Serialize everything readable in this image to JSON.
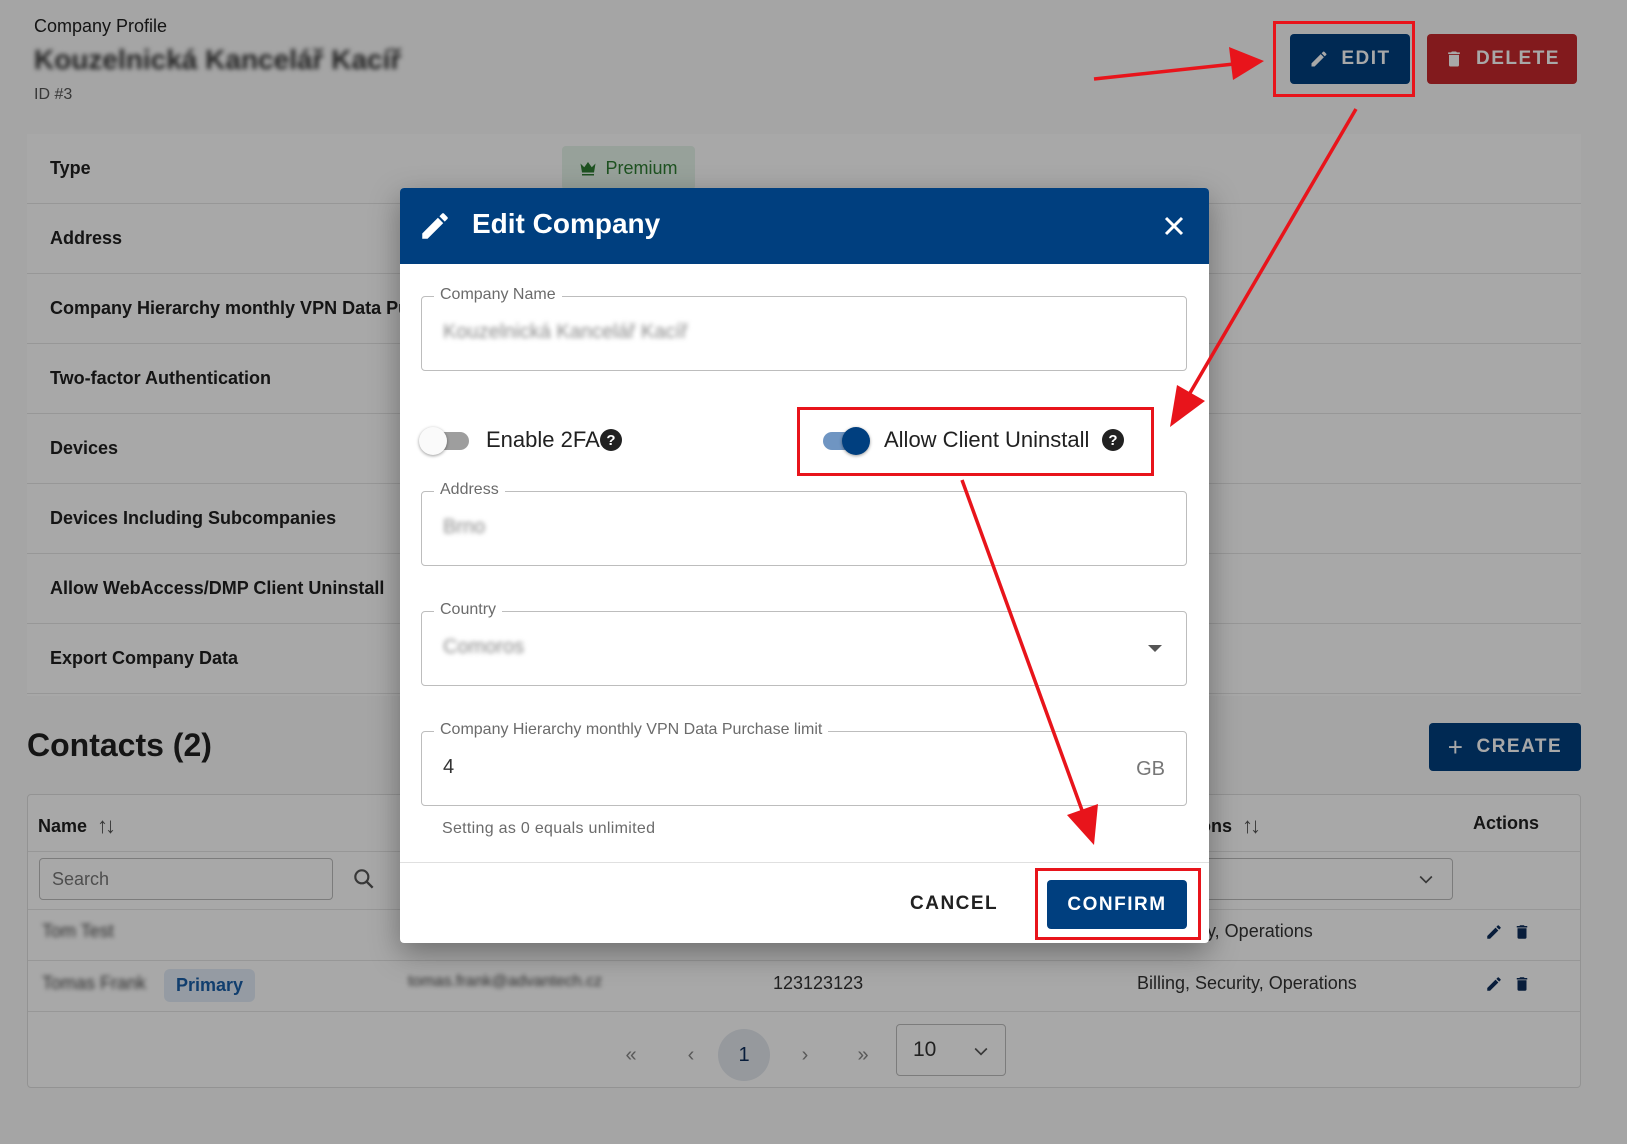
{
  "header": {
    "profile_label": "Company Profile",
    "company_name": "Kouzelnická Kancelář Kacíř",
    "company_id": "ID #3",
    "edit_label": "EDIT",
    "delete_label": "DELETE"
  },
  "details": {
    "rows": [
      "Type",
      "Address",
      "Company Hierarchy monthly VPN Data Pu",
      "Two-factor Authentication",
      "Devices",
      "Devices Including Subcompanies",
      "Allow WebAccess/DMP Client Uninstall",
      "Export Company Data"
    ],
    "type_badge": "Premium"
  },
  "contacts": {
    "title": "Contacts (2)",
    "create_label": "CREATE",
    "columns": {
      "name": "Name",
      "roles": "ons",
      "actions": "Actions"
    },
    "search_placeholder": "Search",
    "rows": [
      {
        "name": "Tom Test",
        "email": "",
        "phone": "",
        "roles": "ecurity, Operations"
      },
      {
        "name": "Tomas Frank",
        "badge": "Primary",
        "email": "tomas.frank@advantech.cz",
        "phone": "123123123",
        "roles": "Billing, Security, Operations"
      }
    ],
    "pagination": {
      "first": "«",
      "prev": "‹",
      "current": "1",
      "next": "›",
      "last": "»",
      "page_size": "10"
    }
  },
  "dialog": {
    "title": "Edit Company",
    "company_name_label": "Company Name",
    "company_name_value": "Kouzelnická Kancelář Kacíř",
    "enable_2fa_label": "Enable 2FA",
    "enable_2fa_on": false,
    "allow_uninstall_label": "Allow Client Uninstall",
    "allow_uninstall_on": true,
    "address_label": "Address",
    "address_value": "Brno",
    "country_label": "Country",
    "country_value": "Comoros",
    "vpn_label": "Company Hierarchy monthly VPN Data Purchase limit",
    "vpn_value": "4",
    "vpn_unit": "GB",
    "vpn_helper": "Setting as 0 equals unlimited",
    "cancel_label": "CANCEL",
    "confirm_label": "CONFIRM"
  },
  "colors": {
    "primary": "#003f7f",
    "danger": "#c6282c",
    "annotation": "#e8141b",
    "premium": "#2e7d32"
  }
}
